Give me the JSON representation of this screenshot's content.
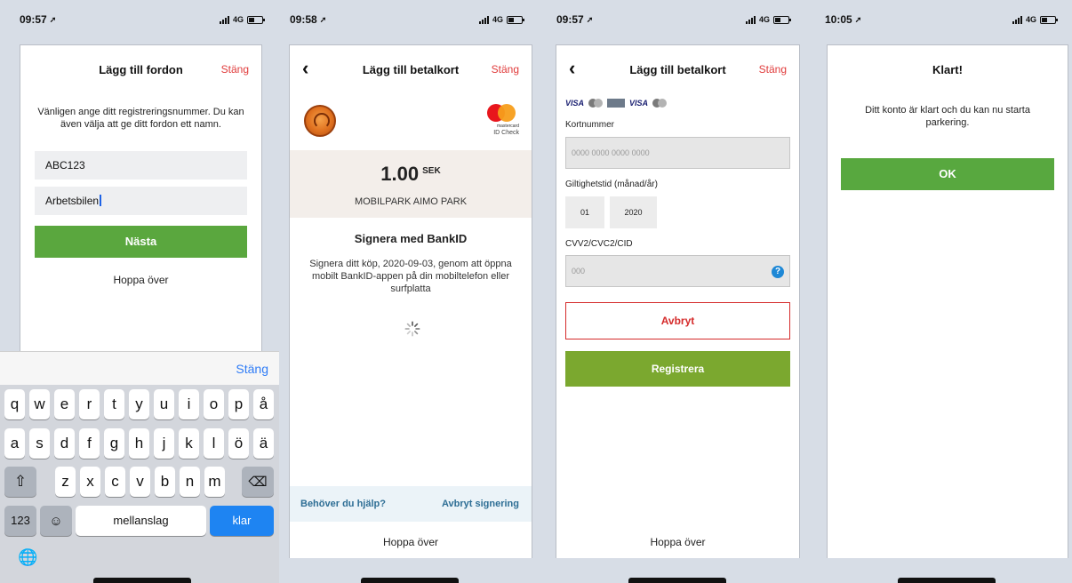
{
  "screen1": {
    "time": "09:57",
    "network": "4G",
    "title": "Lägg till fordon",
    "close": "Stäng",
    "instructions": "Vänligen ange ditt registreringsnummer. Du kan även välja att ge ditt fordon ett namn.",
    "reg_value": "ABC123",
    "name_value": "Arbetsbilen",
    "next_button": "Nästa",
    "skip": "Hoppa över",
    "keyboard": {
      "close": "Stäng",
      "row1": [
        "q",
        "w",
        "e",
        "r",
        "t",
        "y",
        "u",
        "i",
        "o",
        "p",
        "å"
      ],
      "row2": [
        "a",
        "s",
        "d",
        "f",
        "g",
        "h",
        "j",
        "k",
        "l",
        "ö",
        "ä"
      ],
      "row3": [
        "z",
        "x",
        "c",
        "v",
        "b",
        "n",
        "m"
      ],
      "numbers": "123",
      "space": "mellanslag",
      "done": "klar"
    }
  },
  "screen2": {
    "time": "09:58",
    "network": "4G",
    "title": "Lägg till betalkort",
    "close": "Stäng",
    "mastercard_line1": "mastercard",
    "mastercard_line2": "ID Check",
    "amount": "1.00",
    "currency": "SEK",
    "merchant": "MOBILPARK AIMO PARK",
    "bankid_title": "Signera med BankID",
    "bankid_text": "Signera ditt köp, 2020-09-03, genom att öppna mobilt BankID-appen på din mobiltelefon eller surfplatta",
    "help": "Behöver du hjälp?",
    "cancel_signing": "Avbryt signering",
    "skip": "Hoppa över"
  },
  "screen3": {
    "time": "09:57",
    "network": "4G",
    "title": "Lägg till betalkort",
    "close": "Stäng",
    "visa1": "VISA",
    "visa2": "VISA",
    "card_number_label": "Kortnummer",
    "card_number_placeholder": "0000 0000 0000 0000",
    "expiry_label": "Giltighetstid (månad/år)",
    "expiry_month": "01",
    "expiry_year": "2020",
    "cvv_label": "CVV2/CVC2/CID",
    "cvv_placeholder": "000",
    "help_mark": "?",
    "cancel": "Avbryt",
    "register": "Registrera",
    "skip": "Hoppa över"
  },
  "screen4": {
    "time": "10:05",
    "network": "4G",
    "title": "Klart!",
    "text": "Ditt konto är klart och du kan nu starta parkering.",
    "ok": "OK"
  },
  "colors": {
    "green": "#5aa73e",
    "red": "#e03b3b",
    "blue": "#1e84f2",
    "register_green": "#7ba82f",
    "help_blue": "#2e6e95"
  }
}
